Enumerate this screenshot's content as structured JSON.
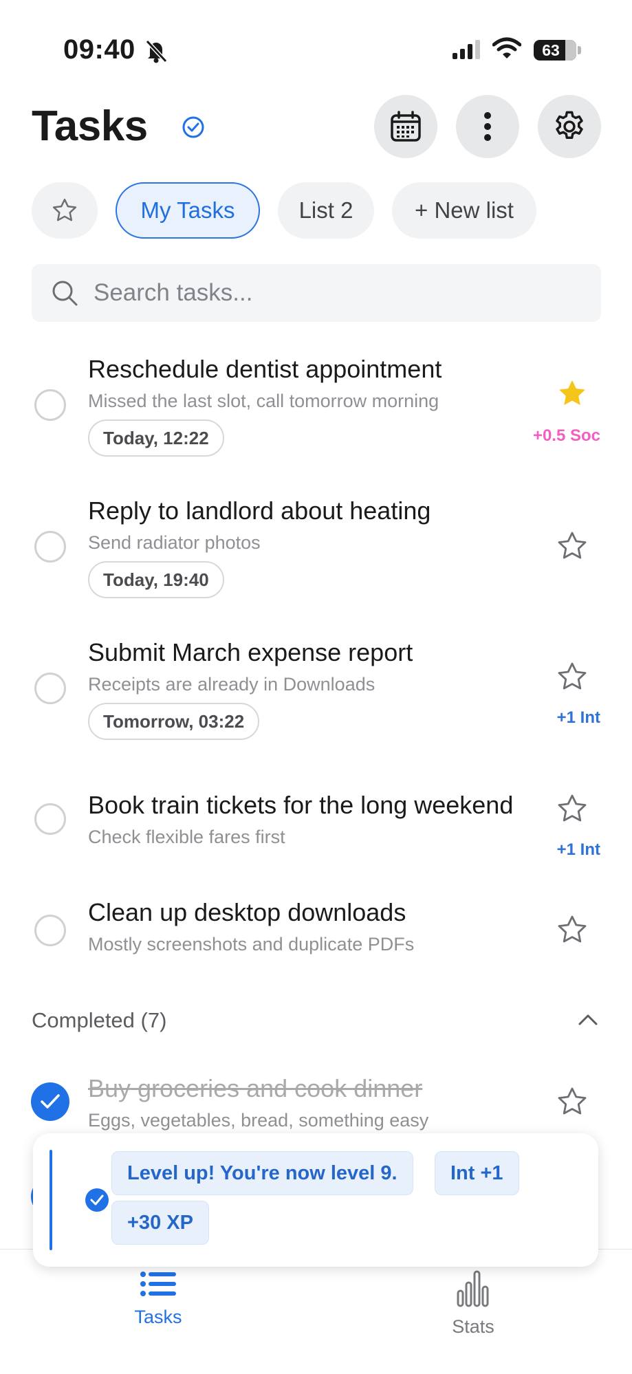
{
  "status_bar": {
    "time": "09:40",
    "battery": "63"
  },
  "header": {
    "title": "Tasks"
  },
  "lists": {
    "items": [
      "My Tasks",
      "List 2",
      "+ New list"
    ]
  },
  "search": {
    "placeholder": "Search tasks..."
  },
  "tasks": [
    {
      "title": "Reschedule dentist appointment",
      "subtitle": "Missed the last slot, call tomorrow morning",
      "date": "Today, 12:22",
      "starred": true,
      "stat": "+0.5 Soc",
      "stat_color": "#f25fc1"
    },
    {
      "title": "Reply to landlord about heating",
      "subtitle": "Send radiator photos",
      "date": "Today, 19:40",
      "starred": false,
      "stat": ""
    },
    {
      "title": "Submit March expense report",
      "subtitle": "Receipts are already in Downloads",
      "date": "Tomorrow, 03:22",
      "starred": false,
      "stat": "+1 Int",
      "stat_color": "#2f72d8"
    },
    {
      "title": "Book train tickets for the long weekend",
      "subtitle": "Check flexible fares first",
      "date": "",
      "starred": false,
      "stat": "+1 Int",
      "stat_color": "#2f72d8"
    },
    {
      "title": "Clean up desktop downloads",
      "subtitle": "Mostly screenshots and duplicate PDFs",
      "date": "",
      "starred": false,
      "stat": ""
    }
  ],
  "completed": {
    "label": "Completed (7)",
    "items": [
      {
        "title": "Buy groceries and cook dinner",
        "subtitle": "Eggs, vegetables, bread, something easy",
        "starred": false
      }
    ]
  },
  "toast": {
    "message": "Level up! You're now level 9.",
    "stat": "Int +1",
    "xp": "+30 XP"
  },
  "bottom_nav": {
    "tasks_label": "Tasks",
    "stats_label": "Stats"
  },
  "colors": {
    "accent": "#2171e6",
    "star_active": "#f5c518",
    "social": "#f25fc1",
    "intellect": "#2f72d8"
  }
}
